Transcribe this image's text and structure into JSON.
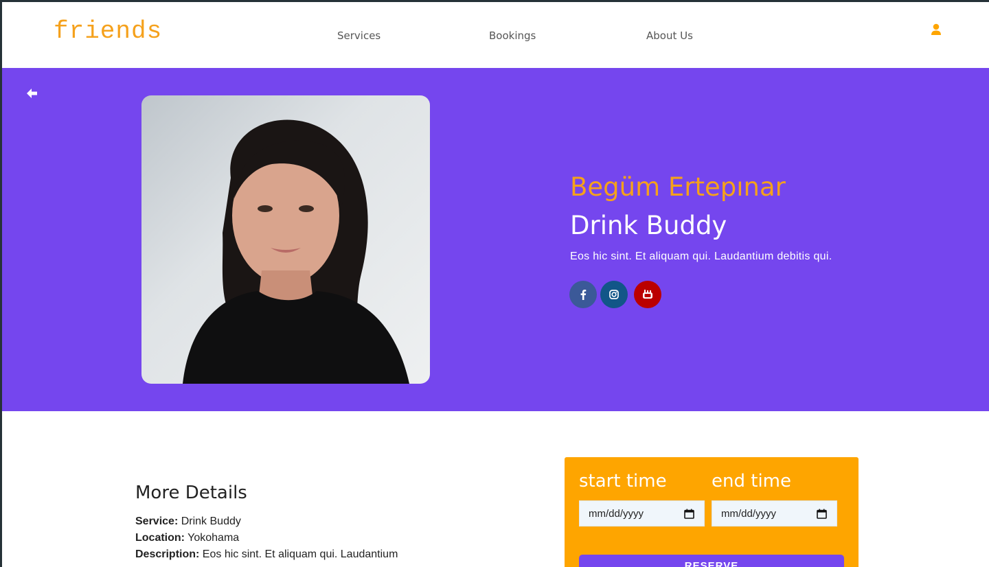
{
  "header": {
    "brand": "friends",
    "nav": [
      "Services",
      "Bookings",
      "About Us"
    ]
  },
  "profile": {
    "name": "Begüm Ertepınar",
    "role": "Drink Buddy",
    "tagline": "Eos hic sint. Et aliquam qui. Laudantium debitis qui.",
    "social": [
      "facebook",
      "instagram",
      "youtube"
    ]
  },
  "details": {
    "title": "More Details",
    "service_label": "Service:",
    "service_value": "Drink Buddy",
    "location_label": "Location:",
    "location_value": "Yokohama",
    "description_label": "Description:",
    "description_value": "Eos hic sint. Et aliquam qui. Laudantium"
  },
  "booking": {
    "start_label": "start time",
    "end_label": "end time",
    "start_value": "mm/dd/yyyy",
    "end_value": "mm/dd/yyyy",
    "reserve_label": "RESERVE"
  },
  "colors": {
    "accent": "#7546ee",
    "brand": "#f5a11c",
    "card": "#fea500",
    "facebook": "#3b5998",
    "instagram": "#125688",
    "youtube": "#bb0000"
  }
}
